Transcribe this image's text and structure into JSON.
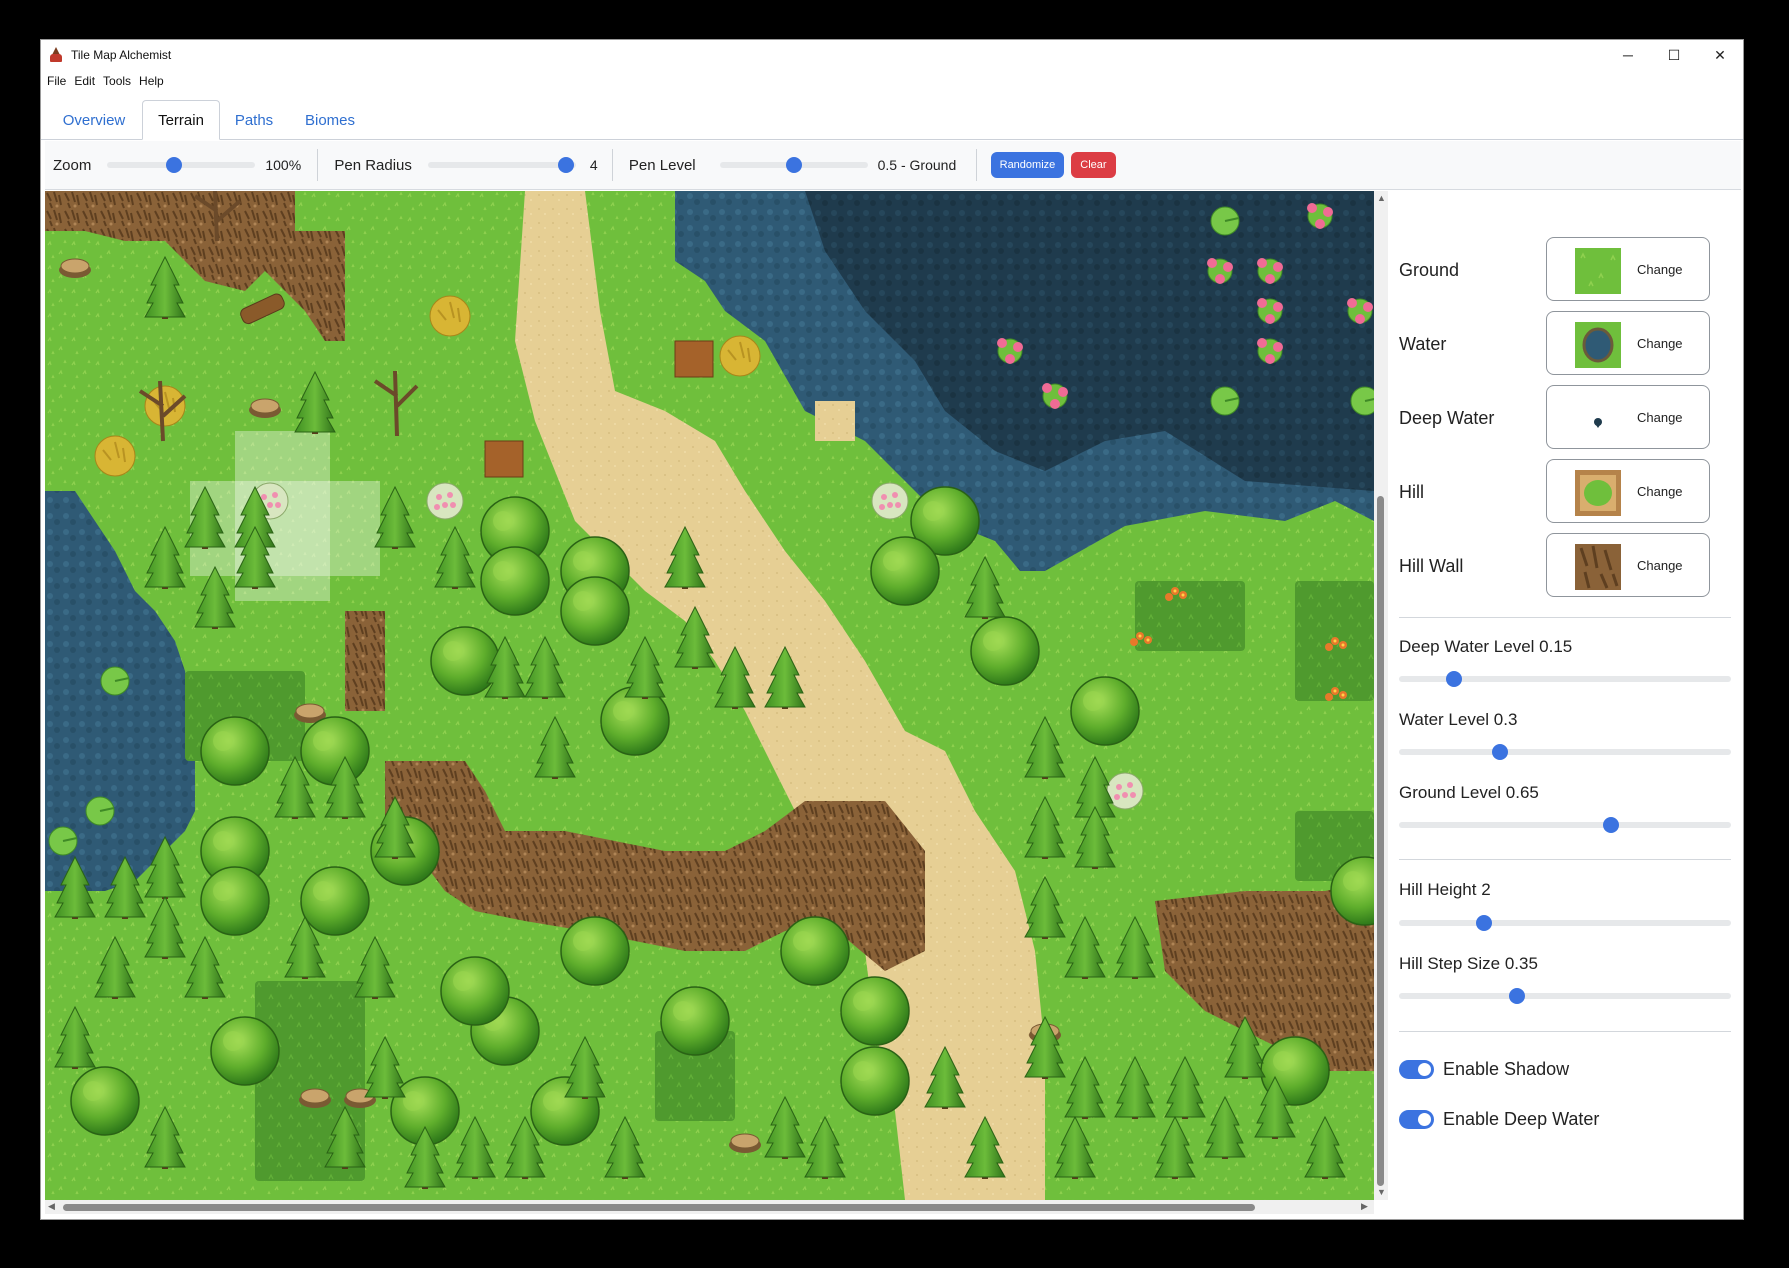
{
  "window": {
    "title": "Tile Map Alchemist",
    "controls": {
      "minimize": "─",
      "maximize": "☐",
      "close": "✕"
    }
  },
  "menu": [
    "File",
    "Edit",
    "Tools",
    "Help"
  ],
  "tabs": [
    {
      "label": "Overview",
      "active": false
    },
    {
      "label": "Terrain",
      "active": true
    },
    {
      "label": "Paths",
      "active": false
    },
    {
      "label": "Biomes",
      "active": false
    }
  ],
  "toolbar": {
    "zoom": {
      "label": "Zoom",
      "value_text": "100%",
      "level": 0.45
    },
    "pen_radius": {
      "label": "Pen Radius",
      "value_text": "4",
      "level": 0.93
    },
    "pen_level": {
      "label": "Pen Level",
      "value_text": "0.5 - Ground",
      "level": 0.5
    },
    "randomize_label": "Randomize",
    "clear_label": "Clear"
  },
  "tiles": [
    {
      "label": "Ground",
      "change_label": "Change",
      "preview": "grass"
    },
    {
      "label": "Water",
      "change_label": "Change",
      "preview": "water-shallow"
    },
    {
      "label": "Deep Water",
      "change_label": "Change",
      "preview": "water-deep"
    },
    {
      "label": "Hill",
      "change_label": "Change",
      "preview": "hill-top"
    },
    {
      "label": "Hill Wall",
      "change_label": "Change",
      "preview": "hill-wall"
    }
  ],
  "params": [
    {
      "label": "Deep Water Level 0.15",
      "value": 0.15
    },
    {
      "label": "Water Level 0.3",
      "value": 0.3
    },
    {
      "label": "Ground Level 0.65",
      "value": 0.65
    },
    {
      "label": "Hill Height 2",
      "value": 2
    },
    {
      "label": "Hill Step Size 0.35",
      "value": 0.35
    }
  ],
  "toggles": [
    {
      "label": "Enable Shadow",
      "on": true
    },
    {
      "label": "Enable Deep Water",
      "on": true
    }
  ],
  "colors": {
    "accent": "#3b73e0",
    "danger": "#dc3d44",
    "grass": "#6fbf3c",
    "water": "#2f5a75",
    "deep_water": "#1f3b4d",
    "path": "#e6cf94",
    "cliff": "#8a6238",
    "tree": "#3f8f22"
  }
}
